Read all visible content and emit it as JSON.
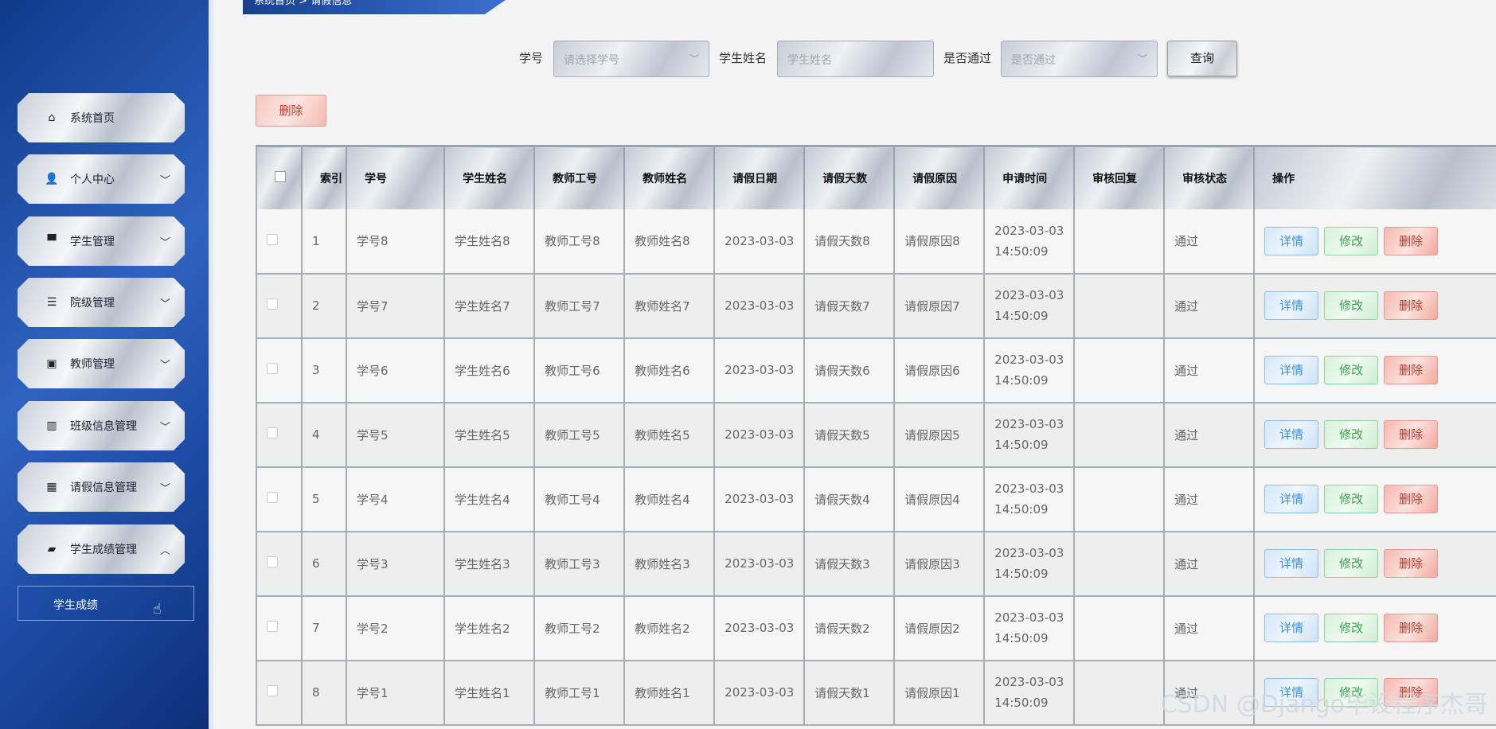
{
  "breadcrumb": {
    "home": "系统首页",
    "sep": ">",
    "current": "请假信息"
  },
  "sidebar": {
    "items": [
      {
        "label": "系统首页",
        "icon": "home-icon",
        "glyph": "⌂",
        "chevron": ""
      },
      {
        "label": "个人中心",
        "icon": "user-icon",
        "glyph": "👤",
        "chevron": "﹀"
      },
      {
        "label": "学生管理",
        "icon": "brush-icon",
        "glyph": "▀",
        "chevron": "﹀"
      },
      {
        "label": "院级管理",
        "icon": "list-icon",
        "glyph": "☰",
        "chevron": "﹀"
      },
      {
        "label": "教师管理",
        "icon": "clipboard-icon",
        "glyph": "▣",
        "chevron": "﹀"
      },
      {
        "label": "班级信息管理",
        "icon": "bar-chart-icon",
        "glyph": "▥",
        "chevron": "﹀"
      },
      {
        "label": "请假信息管理",
        "icon": "grid-icon",
        "glyph": "▦",
        "chevron": "﹀"
      },
      {
        "label": "学生成绩管理",
        "icon": "briefcase-icon",
        "glyph": "▰",
        "chevron": "︿"
      }
    ],
    "submenu": {
      "label": "学生成绩"
    }
  },
  "search": {
    "student_no_label": "学号",
    "student_no_placeholder": "请选择学号",
    "student_name_label": "学生姓名",
    "student_name_placeholder": "学生姓名",
    "passed_label": "是否通过",
    "passed_placeholder": "是否通过",
    "query_button": "查询"
  },
  "toolbar": {
    "delete_button": "删除"
  },
  "table": {
    "headers": [
      "",
      "索引",
      "学号",
      "学生姓名",
      "教师工号",
      "教师姓名",
      "请假日期",
      "请假天数",
      "请假原因",
      "申请时间",
      "审核回复",
      "审核状态",
      "操作"
    ],
    "rows": [
      {
        "index": "1",
        "student_no": "学号8",
        "student_name": "学生姓名8",
        "teacher_no": "教师工号8",
        "teacher_name": "教师姓名8",
        "leave_date": "2023-03-03",
        "leave_days": "请假天数8",
        "reason": "请假原因8",
        "apply_date": "2023-03-03",
        "apply_time": "14:50:09",
        "reply": "",
        "status": "通过"
      },
      {
        "index": "2",
        "student_no": "学号7",
        "student_name": "学生姓名7",
        "teacher_no": "教师工号7",
        "teacher_name": "教师姓名7",
        "leave_date": "2023-03-03",
        "leave_days": "请假天数7",
        "reason": "请假原因7",
        "apply_date": "2023-03-03",
        "apply_time": "14:50:09",
        "reply": "",
        "status": "通过"
      },
      {
        "index": "3",
        "student_no": "学号6",
        "student_name": "学生姓名6",
        "teacher_no": "教师工号6",
        "teacher_name": "教师姓名6",
        "leave_date": "2023-03-03",
        "leave_days": "请假天数6",
        "reason": "请假原因6",
        "apply_date": "2023-03-03",
        "apply_time": "14:50:09",
        "reply": "",
        "status": "通过"
      },
      {
        "index": "4",
        "student_no": "学号5",
        "student_name": "学生姓名5",
        "teacher_no": "教师工号5",
        "teacher_name": "教师姓名5",
        "leave_date": "2023-03-03",
        "leave_days": "请假天数5",
        "reason": "请假原因5",
        "apply_date": "2023-03-03",
        "apply_time": "14:50:09",
        "reply": "",
        "status": "通过"
      },
      {
        "index": "5",
        "student_no": "学号4",
        "student_name": "学生姓名4",
        "teacher_no": "教师工号4",
        "teacher_name": "教师姓名4",
        "leave_date": "2023-03-03",
        "leave_days": "请假天数4",
        "reason": "请假原因4",
        "apply_date": "2023-03-03",
        "apply_time": "14:50:09",
        "reply": "",
        "status": "通过"
      },
      {
        "index": "6",
        "student_no": "学号3",
        "student_name": "学生姓名3",
        "teacher_no": "教师工号3",
        "teacher_name": "教师姓名3",
        "leave_date": "2023-03-03",
        "leave_days": "请假天数3",
        "reason": "请假原因3",
        "apply_date": "2023-03-03",
        "apply_time": "14:50:09",
        "reply": "",
        "status": "通过"
      },
      {
        "index": "7",
        "student_no": "学号2",
        "student_name": "学生姓名2",
        "teacher_no": "教师工号2",
        "teacher_name": "教师姓名2",
        "leave_date": "2023-03-03",
        "leave_days": "请假天数2",
        "reason": "请假原因2",
        "apply_date": "2023-03-03",
        "apply_time": "14:50:09",
        "reply": "",
        "status": "通过"
      },
      {
        "index": "8",
        "student_no": "学号1",
        "student_name": "学生姓名1",
        "teacher_no": "教师工号1",
        "teacher_name": "教师姓名1",
        "leave_date": "2023-03-03",
        "leave_days": "请假天数1",
        "reason": "请假原因1",
        "apply_date": "2023-03-03",
        "apply_time": "14:50:09",
        "reply": "",
        "status": "通过"
      }
    ],
    "actions": {
      "detail": "详情",
      "edit": "修改",
      "delete": "删除"
    }
  },
  "watermark": "CSDN @Django毕设程序杰哥",
  "colors": {
    "sidebar": "#1c4aa3",
    "detail": "#3a8fd8",
    "edit": "#3aa14a",
    "delete": "#c0392b"
  }
}
